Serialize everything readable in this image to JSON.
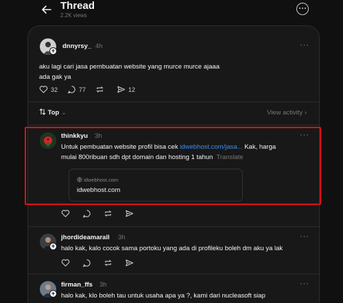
{
  "header": {
    "title": "Thread",
    "views": "2.2K views"
  },
  "posts": [
    {
      "username": "dnnyrsy_",
      "time": "4h",
      "line1": "aku lagi cari jasa pembuatan website yang murce murce ajaaa",
      "line2": "ada gak ya",
      "likes": "32",
      "comments": "77",
      "shares": "12"
    }
  ],
  "sort": {
    "label": "Top",
    "view_activity": "View activity"
  },
  "replies": [
    {
      "username": "thinkkyu",
      "time": "3h",
      "text_a": "Untuk pembuatan website profil bisa cek ",
      "link": "idwebhost.com/jasa...",
      "text_b": " Kak, harga",
      "line2": "mulai 800ribuan sdh dpt domain dan hosting 1 tahun",
      "translate": "Translate",
      "card_domain": "idwebhost.com",
      "card_title": "idwebhost.com"
    },
    {
      "username": "jhordideamarall",
      "time": "3h",
      "text": "halo kak, kalo cocok sama portoku yang ada di profileku boleh dm aku ya lak"
    },
    {
      "username": "firman_ffs",
      "time": "3h",
      "text": "halo kak, klo boleh tau untuk usaha apa ya ?, kami dari nucleasoft siap"
    }
  ],
  "colors": {
    "background": "#101010",
    "card": "#181818",
    "link": "#3b8df0",
    "highlight": "#e0101a"
  },
  "icons": [
    "back-arrow-icon",
    "more-icon",
    "heart-icon",
    "comment-icon",
    "repost-icon",
    "share-icon",
    "globe-icon",
    "sort-icon",
    "chevron-down-icon",
    "chevron-right-icon"
  ]
}
